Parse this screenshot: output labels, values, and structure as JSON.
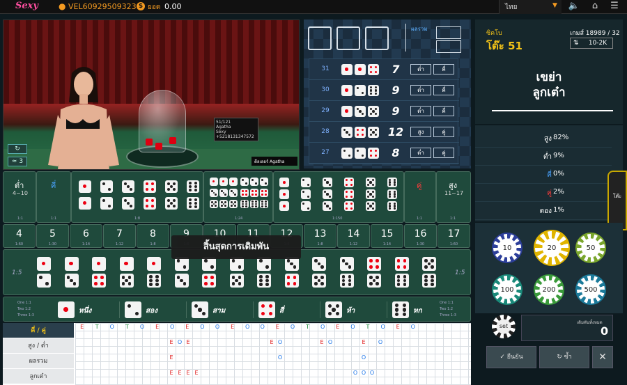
{
  "topbar": {
    "logo": "Sexy",
    "username": "VEL60929509323",
    "balance_label": "ยอด",
    "balance": "0.00",
    "language": "ไทย"
  },
  "video": {
    "board_line1": "51/121",
    "board_line2": "Agatha",
    "board_line3": "Sexy",
    "board_line4": "+5218131347572",
    "dealer_tag": "ดีลเลอร์ Agatha",
    "counter": "3"
  },
  "sum_label": "ผลรวม",
  "history": [
    {
      "round": "31",
      "dice": [
        1,
        1,
        4
      ],
      "total": "7",
      "r1": "ต่ำ",
      "r2": "คี่"
    },
    {
      "round": "30",
      "dice": [
        1,
        2,
        6
      ],
      "total": "9",
      "r1": "ต่ำ",
      "r2": "คี่"
    },
    {
      "round": "29",
      "dice": [
        1,
        3,
        5
      ],
      "total": "9",
      "r1": "ต่ำ",
      "r2": "คี่"
    },
    {
      "round": "28",
      "dice": [
        3,
        4,
        5
      ],
      "total": "12",
      "r1": "สูง",
      "r2": "คู่"
    },
    {
      "round": "27",
      "dice": [
        2,
        2,
        4
      ],
      "total": "8",
      "r1": "ต่ำ",
      "r2": "คู่"
    }
  ],
  "panel": {
    "table_label": "ซิคโบ",
    "table_name": "โต๊ะ 51",
    "game_no": "เกมส์ 18989 / 32",
    "limit": "10-2K",
    "game_line1": "เขย่า",
    "game_line2": "ลูกเต๋า",
    "side_tab": "โต๊ะ"
  },
  "stats": [
    {
      "label": "สูง",
      "value": "82%",
      "color": "#ffffff"
    },
    {
      "label": "ต่ำ",
      "value": "9%",
      "color": "#ffffff"
    },
    {
      "label": "คี่",
      "value": "0%",
      "color": "#4aa3ff"
    },
    {
      "label": "คู่",
      "value": "2%",
      "color": "#ff3b3b"
    },
    {
      "label": "ตอง",
      "value": "1%",
      "color": "#ffffff"
    }
  ],
  "chips": [
    {
      "value": "10",
      "color": "#2d3f9a"
    },
    {
      "value": "20",
      "color": "#e0b400"
    },
    {
      "value": "50",
      "color": "#7aa62c"
    },
    {
      "value": "100",
      "color": "#1a8a7a"
    },
    {
      "value": "200",
      "color": "#3a9a3a"
    },
    {
      "value": "500",
      "color": "#1b7a9a"
    }
  ],
  "set_chip": "set",
  "total_bet_label": "เดิมพันทั้งหมด",
  "total_bet": "0",
  "buttons": {
    "confirm": "ยืนยัน",
    "repeat": "ซ้ำ"
  },
  "board": {
    "low_label": "ต่ำ",
    "low_range": "4~10",
    "odd_label": "คี่",
    "even_label": "คู่",
    "high_label": "สูง",
    "high_range": "11~17",
    "odds_1to1": "1:1",
    "odds_8": "1:8",
    "odds_24": "1:24",
    "odds_150": "1:150",
    "closed": "สิ้นสุดการเดิมพัน",
    "pair_odds": "1:5",
    "single_odds_left": [
      "One 1:1",
      "Two 1:2",
      "Three 1:3"
    ],
    "single_odds_right": [
      "One 1:1",
      "Two 1:2",
      "Three 1:3"
    ],
    "singles": [
      "หนึ่ง",
      "สอง",
      "สาม",
      "สี่",
      "ห้า",
      "หก"
    ]
  },
  "totals": [
    {
      "n": "4",
      "o": "1:60"
    },
    {
      "n": "5",
      "o": "1:30"
    },
    {
      "n": "6",
      "o": "1:14"
    },
    {
      "n": "7",
      "o": "1:12"
    },
    {
      "n": "8",
      "o": "1:8"
    },
    {
      "n": "9",
      "o": "1:6"
    },
    {
      "n": "10",
      "o": "1:6"
    },
    {
      "n": "11",
      "o": "1:6"
    },
    {
      "n": "12",
      "o": "1:6"
    },
    {
      "n": "13",
      "o": "1:8"
    },
    {
      "n": "14",
      "o": "1:12"
    },
    {
      "n": "15",
      "o": "1:14"
    },
    {
      "n": "16",
      "o": "1:30"
    },
    {
      "n": "17",
      "o": "1:60"
    }
  ],
  "road": {
    "labels": [
      "คี่ / คู่",
      "สูง / ต่ำ",
      "ผลรวม",
      "ลูกเต๋า"
    ],
    "row1": [
      "E",
      "T",
      "O",
      "T",
      "O",
      "E",
      "O",
      "E",
      "O",
      "O",
      "E",
      "O",
      "O",
      "E",
      "O",
      "T",
      "O",
      "E",
      "O",
      "T",
      "O",
      "E",
      "O"
    ],
    "row2": [
      "E",
      "O",
      "E",
      "E",
      "O",
      "E",
      "O",
      "E",
      "O"
    ],
    "row3": [
      "E",
      "O",
      "O"
    ],
    "row4": [
      "E",
      "E",
      "E",
      "E",
      "O",
      "O",
      "O"
    ]
  }
}
